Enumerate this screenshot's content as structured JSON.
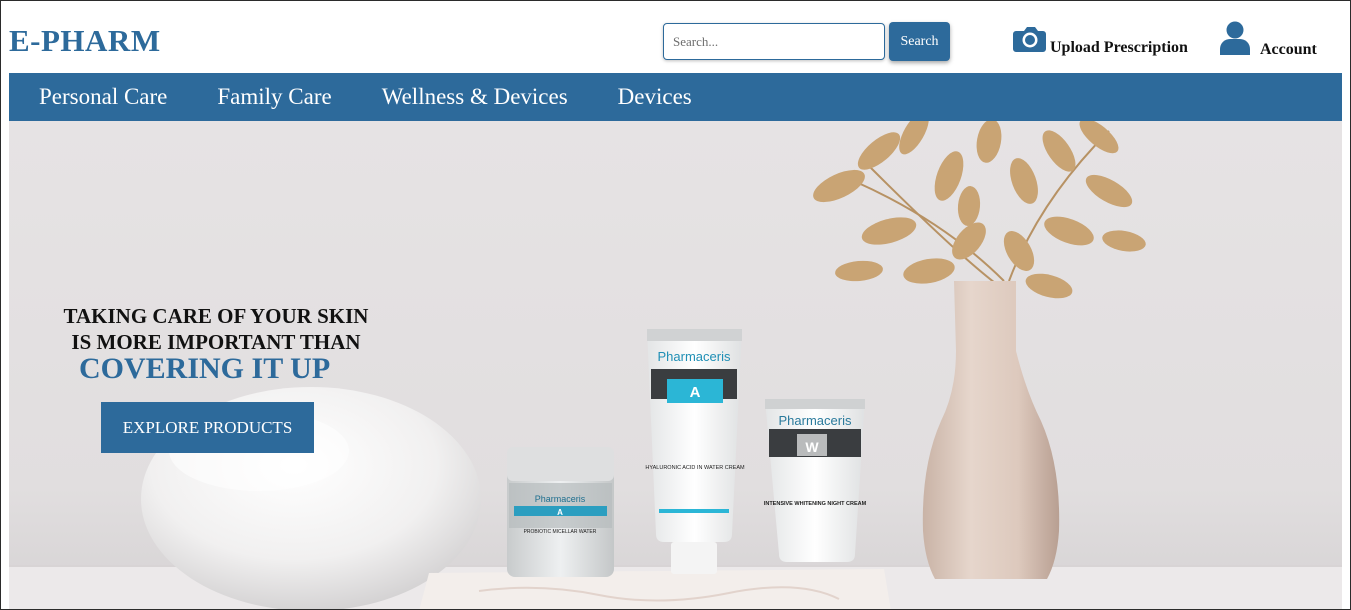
{
  "header": {
    "logo": "E-PHARM",
    "search": {
      "placeholder": "Search...",
      "button_label": "Search"
    },
    "upload_label": "Upload Prescription",
    "upload_icon": "camera-icon",
    "account_label": "Account",
    "account_icon": "user-icon"
  },
  "nav": {
    "items": [
      {
        "label": "Personal Care"
      },
      {
        "label": "Family Care"
      },
      {
        "label": "Wellness & Devices"
      },
      {
        "label": "Devices"
      }
    ]
  },
  "hero": {
    "line1": "TAKING CARE OF YOUR SKIN",
    "line2": "IS MORE IMPORTANT THAN",
    "line3": "COVERING IT UP",
    "cta_label": "EXPLORE PRODUCTS",
    "products": {
      "jar_brand": "Pharmaceris",
      "jar_letter": "A",
      "jar_text": "PROBIOTIC MICELLAR WATER",
      "tube1_brand": "Pharmaceris",
      "tube1_letter": "A",
      "tube1_text": "HYALURONIC ACID IN WATER CREAM",
      "tube2_brand": "Pharmaceris",
      "tube2_letter": "W",
      "tube2_text": "INTENSIVE WHITENING NIGHT CREAM"
    }
  },
  "colors": {
    "brand": "#2d6a9b",
    "hero_wall": "#e8e6e6",
    "vase": "#ddc9bd"
  }
}
